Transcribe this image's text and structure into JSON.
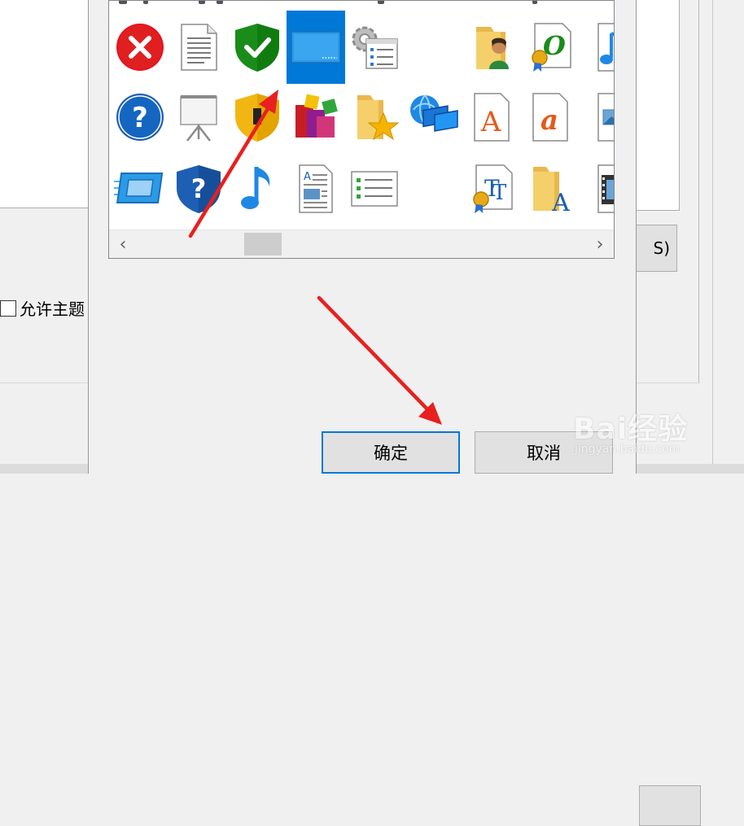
{
  "parent_dialog": {
    "checkbox_label": "允许主题",
    "button_fragment": "S)",
    "checkbox_checked": false
  },
  "icon_dialog": {
    "ok_label": "确定",
    "cancel_label": "取消",
    "selected_icon": "blank-monitor-icon",
    "icons": [
      {
        "name": "error-x-icon",
        "row": 0,
        "col": 0
      },
      {
        "name": "text-document-icon",
        "row": 0,
        "col": 1
      },
      {
        "name": "green-shield-check-icon",
        "row": 0,
        "col": 2
      },
      {
        "name": "blank-monitor-icon",
        "row": 0,
        "col": 3
      },
      {
        "name": "settings-checklist-icon",
        "row": 0,
        "col": 4
      },
      {
        "name": "user-folder-icon",
        "row": 0,
        "col": 6
      },
      {
        "name": "certified-font-icon",
        "row": 0,
        "col": 7
      },
      {
        "name": "music-note-icon",
        "row": 0,
        "col": 8
      },
      {
        "name": "help-question-icon",
        "row": 1,
        "col": 0
      },
      {
        "name": "projector-screen-icon",
        "row": 1,
        "col": 1
      },
      {
        "name": "yellow-shield-icon",
        "row": 1,
        "col": 2
      },
      {
        "name": "app-blocks-icon",
        "row": 1,
        "col": 3
      },
      {
        "name": "favorites-folder-icon",
        "row": 1,
        "col": 4
      },
      {
        "name": "network-globe-icon",
        "row": 1,
        "col": 5
      },
      {
        "name": "font-a-icon",
        "row": 1,
        "col": 6
      },
      {
        "name": "font-italic-a-icon",
        "row": 1,
        "col": 7
      },
      {
        "name": "image-document-icon",
        "row": 1,
        "col": 8
      },
      {
        "name": "display-settings-icon",
        "row": 2,
        "col": 0
      },
      {
        "name": "blue-shield-question-icon",
        "row": 2,
        "col": 1
      },
      {
        "name": "blue-music-note-icon",
        "row": 2,
        "col": 2
      },
      {
        "name": "article-document-icon",
        "row": 2,
        "col": 3
      },
      {
        "name": "list-document-icon",
        "row": 2,
        "col": 4
      },
      {
        "name": "truetype-font-icon",
        "row": 2,
        "col": 6
      },
      {
        "name": "fonts-folder-icon",
        "row": 2,
        "col": 7
      },
      {
        "name": "film-strip-icon",
        "row": 2,
        "col": 8
      }
    ]
  },
  "watermark": {
    "brand": "Bai经验",
    "sub": "jingyan.baidu.com"
  },
  "colors": {
    "selection": "#0078d7",
    "arrow": "#e8201f",
    "dialog_bg": "#f0f0f0"
  }
}
